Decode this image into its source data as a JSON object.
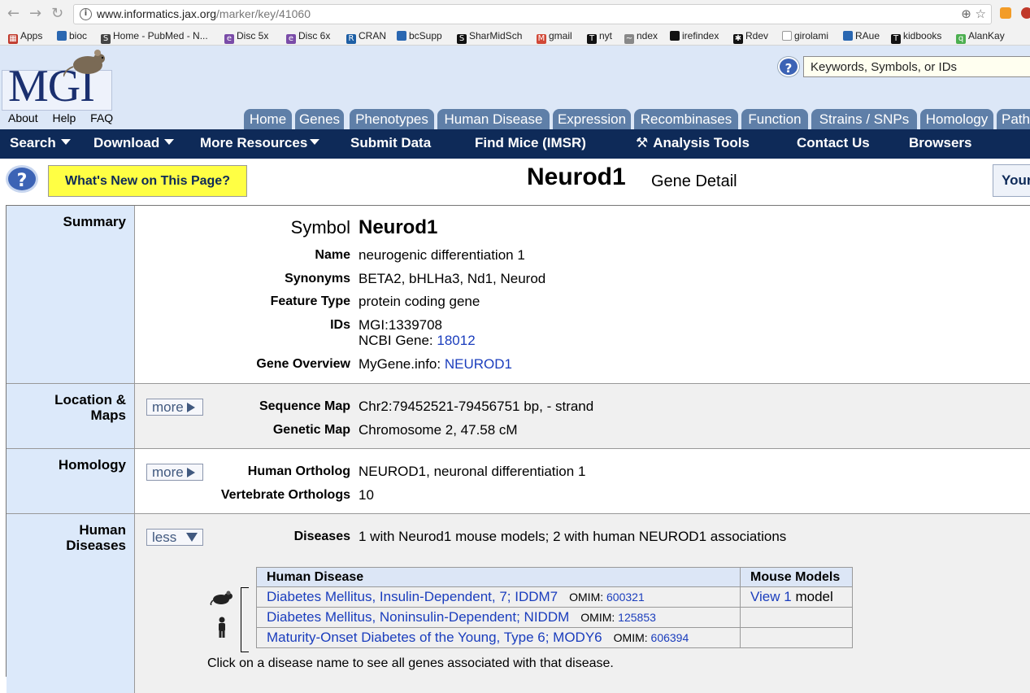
{
  "browser": {
    "url_host": "www.informatics.jax.org",
    "url_path": "/marker/key/41060",
    "bookmarks": [
      "Apps",
      "bioc",
      "Home - PubMed - N...",
      "Disc 5x",
      "Disc 6x",
      "CRAN",
      "bcSupp",
      "SharMidSch",
      "gmail",
      "nyt",
      "ndex",
      "irefindex",
      "Rdev",
      "girolami",
      "RAue",
      "kidbooks",
      "AlanKay"
    ]
  },
  "header": {
    "logo_text": "MGI",
    "links": [
      "About",
      "Help",
      "FAQ"
    ],
    "search_placeholder": "Keywords, Symbols, or IDs",
    "tabs": [
      "Home",
      "Genes",
      "Phenotypes",
      "Human Disease",
      "Expression",
      "Recombinases",
      "Function",
      "Strains / SNPs",
      "Homology",
      "Path"
    ]
  },
  "menubar": {
    "items": [
      "Search",
      "Download",
      "More Resources",
      "Submit Data",
      "Find Mice (IMSR)",
      "Analysis Tools",
      "Contact Us",
      "Browsers"
    ]
  },
  "title_row": {
    "whats_new": "What's New on This Page?",
    "gene": "Neurod1",
    "subtitle": "Gene Detail",
    "your_button": "Your"
  },
  "summary": {
    "label": "Summary",
    "symbol_label": "Symbol",
    "symbol": "Neurod1",
    "name_label": "Name",
    "name": "neurogenic differentiation 1",
    "synonyms_label": "Synonyms",
    "synonyms": "BETA2, bHLHa3, Nd1, Neurod",
    "feature_type_label": "Feature Type",
    "feature_type": "protein coding gene",
    "ids_label": "IDs",
    "mgi_id": "MGI:1339708",
    "ncbi_prefix": "NCBI Gene:",
    "ncbi_id": "18012",
    "overview_label": "Gene Overview",
    "overview_prefix": "MyGene.info:",
    "overview_link": "NEUROD1"
  },
  "location": {
    "label_line1": "Location &",
    "label_line2": "Maps",
    "more": "more",
    "sequence_map_label": "Sequence Map",
    "sequence_map": "Chr2:79452521-79456751 bp, - strand",
    "genetic_map_label": "Genetic Map",
    "genetic_map": "Chromosome 2, 47.58 cM"
  },
  "homology": {
    "label": "Homology",
    "more": "more",
    "human_ortholog_label": "Human Ortholog",
    "human_ortholog": "NEUROD1, neuronal differentiation 1",
    "vertebrate_label": "Vertebrate Orthologs",
    "vertebrate": "10"
  },
  "human_diseases": {
    "label_line1": "Human",
    "label_line2": "Diseases",
    "less": "less",
    "diseases_label": "Diseases",
    "diseases": "1 with Neurod1 mouse models; 2 with human NEUROD1 associations",
    "col_disease": "Human Disease",
    "col_models": "Mouse Models",
    "rows": [
      {
        "name": "Diabetes Mellitus, Insulin-Dependent, 7; IDDM7",
        "omim_label": "OMIM:",
        "omim": "600321",
        "view": "View",
        "count": "1",
        "model": "model"
      },
      {
        "name": "Diabetes Mellitus, Noninsulin-Dependent; NIDDM",
        "omim_label": "OMIM:",
        "omim": "125853"
      },
      {
        "name": "Maturity-Onset Diabetes of the Young, Type 6; MODY6",
        "omim_label": "OMIM:",
        "omim": "606394"
      }
    ],
    "note": "Click on a disease name to see all genes associated with that disease."
  }
}
